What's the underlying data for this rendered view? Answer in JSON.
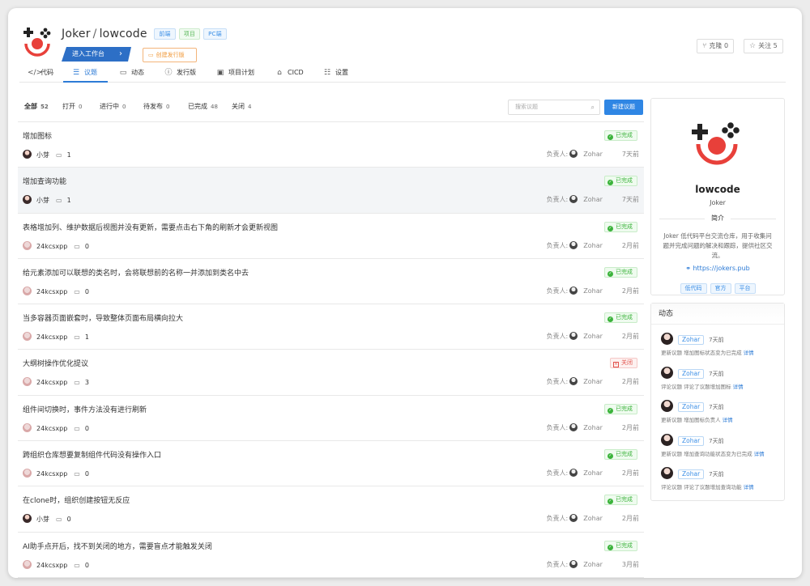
{
  "header": {
    "owner": "Joker",
    "separator": "/",
    "repo": "lowcode",
    "tags": [
      "前端",
      "项目",
      "PC端"
    ],
    "enter_workspace": "进入工作台",
    "create_release": "创建发行版",
    "clone_label": "克隆",
    "clone_count": "0",
    "follow_label": "关注",
    "follow_count": "5"
  },
  "tabs": [
    {
      "label": "代码",
      "icon": "code-icon"
    },
    {
      "label": "议题",
      "icon": "issues-icon"
    },
    {
      "label": "动态",
      "icon": "activity-icon"
    },
    {
      "label": "发行版",
      "icon": "release-icon"
    },
    {
      "label": "项目计划",
      "icon": "plan-icon"
    },
    {
      "label": "CICD",
      "icon": "cicd-icon"
    },
    {
      "label": "设置",
      "icon": "settings-icon"
    }
  ],
  "active_tab": "议题",
  "filters": [
    {
      "label": "全部",
      "count": "52"
    },
    {
      "label": "打开",
      "count": "0"
    },
    {
      "label": "进行中",
      "count": "0"
    },
    {
      "label": "待发布",
      "count": "0"
    },
    {
      "label": "已完成",
      "count": "48"
    },
    {
      "label": "关闭",
      "count": "4"
    }
  ],
  "search": {
    "placeholder": "搜索议题"
  },
  "new_issue": "新建议题",
  "assignee_label": "负责人:",
  "issues": [
    {
      "title": "增加图标",
      "status": "已完成",
      "author": "小芽",
      "comments": "1",
      "assignee": "Zohar",
      "time": "7天前"
    },
    {
      "title": "增加查询功能",
      "status": "已完成",
      "author": "小芽",
      "comments": "1",
      "assignee": "Zohar",
      "time": "7天前"
    },
    {
      "title": "表格增加列、维护数据后视图并没有更新，需要点击右下角的刷新才会更新视图",
      "status": "已完成",
      "author": "24kcsxpp",
      "comments": "0",
      "assignee": "Zohar",
      "time": "2月前"
    },
    {
      "title": "给元素添加可以联想的类名时，会将联想前的名称一并添加到类名中去",
      "status": "已完成",
      "author": "24kcsxpp",
      "comments": "0",
      "assignee": "Zohar",
      "time": "2月前"
    },
    {
      "title": "当多容器页面嵌套时，导致整体页面布局横向拉大",
      "status": "已完成",
      "author": "24kcsxpp",
      "comments": "1",
      "assignee": "Zohar",
      "time": "2月前"
    },
    {
      "title": "大纲树操作优化提议",
      "status": "关闭",
      "author": "24kcsxpp",
      "comments": "3",
      "assignee": "Zohar",
      "time": "2月前"
    },
    {
      "title": "组件间切换时，事件方法没有进行刷新",
      "status": "已完成",
      "author": "24kcsxpp",
      "comments": "0",
      "assignee": "Zohar",
      "time": "2月前"
    },
    {
      "title": "跨组织仓库想要复制组件代码没有操作入口",
      "status": "已完成",
      "author": "24kcsxpp",
      "comments": "0",
      "assignee": "Zohar",
      "time": "2月前"
    },
    {
      "title": "在clone时，组织创建按钮无反应",
      "status": "已完成",
      "author": "小芽",
      "comments": "0",
      "assignee": "Zohar",
      "time": "2月前"
    },
    {
      "title": "AI助手点开后，找不到关闭的地方，需要盲点才能触发关闭",
      "status": "已完成",
      "author": "24kcsxpp",
      "comments": "0",
      "assignee": "Zohar",
      "time": "3月前"
    }
  ],
  "profile": {
    "name": "lowcode",
    "org": "Joker",
    "intro_title": "简介",
    "description": "Joker 低代码平台交流仓库，用于收集问题并完成问题的解决和跟踪，提供社区交流。",
    "link": "https://jokers.pub",
    "tags": [
      "低代码",
      "官方",
      "平台"
    ]
  },
  "activity": {
    "title": "动态",
    "detail_label": "详情",
    "items": [
      {
        "user": "Zohar",
        "time": "7天前",
        "desc": "更新议题 增加图标状态变为已完成"
      },
      {
        "user": "Zohar",
        "time": "7天前",
        "desc": "评论议题 评论了议题增加图标"
      },
      {
        "user": "Zohar",
        "time": "7天前",
        "desc": "更新议题 增加图标负责人"
      },
      {
        "user": "Zohar",
        "time": "7天前",
        "desc": "更新议题 增加查询功能状态变为已完成"
      },
      {
        "user": "Zohar",
        "time": "7天前",
        "desc": "评论议题 评论了议题增加查询功能"
      }
    ]
  },
  "colors": {
    "accent": "#2d7bd6",
    "done": "#3bb33b",
    "closed": "#e2524c",
    "logo_red": "#e8403a"
  }
}
